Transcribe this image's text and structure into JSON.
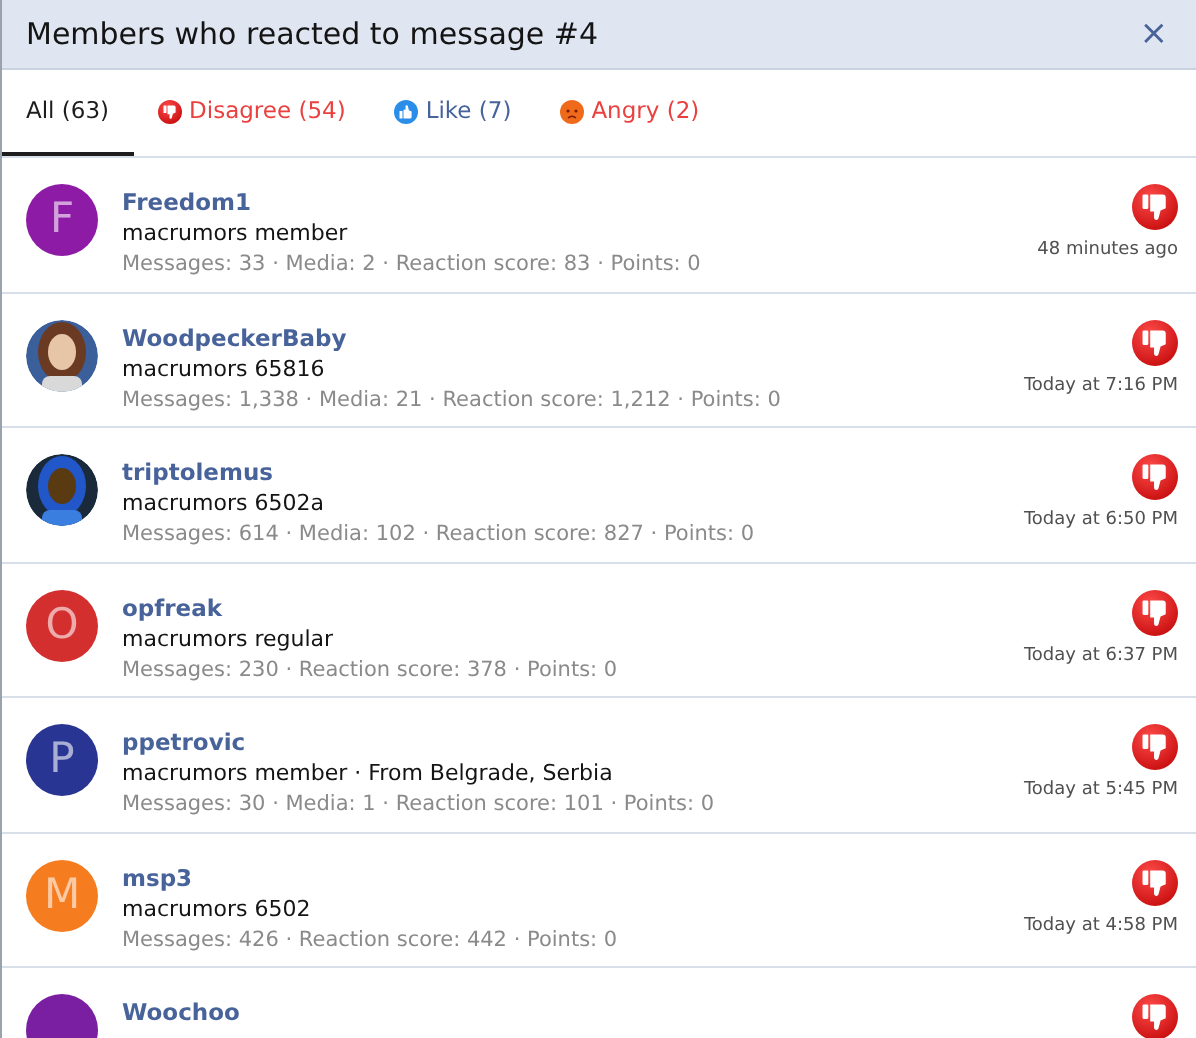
{
  "dialog": {
    "title": "Members who reacted to message #4",
    "close": "×"
  },
  "tabs": [
    {
      "kind": "all",
      "label": "All (63)",
      "selected": true
    },
    {
      "kind": "disagree",
      "label": "Disagree (54)",
      "selected": false
    },
    {
      "kind": "like",
      "label": "Like (7)",
      "selected": false
    },
    {
      "kind": "angry",
      "label": "Angry (2)",
      "selected": false
    }
  ],
  "members": [
    {
      "avatar": {
        "kind": "letter",
        "letter": "F",
        "color": "#8e1ba6"
      },
      "name": "Freedom1",
      "title": "macrumors member",
      "stats": "Messages: 33 · Media: 2 · Reaction score: 83 · Points: 0",
      "reaction": {
        "kind": "disagree"
      },
      "time": "48 minutes ago"
    },
    {
      "name": "WoodpeckerBaby",
      "title": "macrumors 65816",
      "stats": "Messages: 1,338 · Media: 21 · Reaction score: 1,212 · Points: 0",
      "reaction": {
        "kind": "disagree"
      },
      "time": "Today at 7:16 PM"
    },
    {
      "name": "triptolemus",
      "title": "macrumors 6502a",
      "stats": "Messages: 614 · Media: 102 · Reaction score: 827 · Points: 0",
      "reaction": {
        "kind": "disagree"
      },
      "time": "Today at 6:50 PM"
    },
    {
      "avatar": {
        "kind": "letter",
        "letter": "O",
        "color": "#d32f2f"
      },
      "name": "opfreak",
      "title": "macrumors regular",
      "stats": "Messages: 230 · Reaction score: 378 · Points: 0",
      "reaction": {
        "kind": "disagree"
      },
      "time": "Today at 6:37 PM"
    },
    {
      "avatar": {
        "kind": "letter",
        "letter": "P",
        "color": "#283593"
      },
      "name": "ppetrovic",
      "title": "macrumors member · From Belgrade, Serbia",
      "stats": "Messages: 30 · Media: 1 · Reaction score: 101 · Points: 0",
      "reaction": {
        "kind": "disagree"
      },
      "time": "Today at 5:45 PM"
    },
    {
      "avatar": {
        "kind": "letter",
        "letter": "M",
        "color": "#f57c1f"
      },
      "name": "msp3",
      "title": "macrumors 6502",
      "stats": "Messages: 426 · Reaction score: 442 · Points: 0",
      "reaction": {
        "kind": "disagree"
      },
      "time": "Today at 4:58 PM"
    },
    {
      "avatar": {
        "kind": "letter",
        "color": "#7b1fa2"
      },
      "name": "Woochoo",
      "reaction": {
        "kind": "disagree"
      }
    }
  ]
}
